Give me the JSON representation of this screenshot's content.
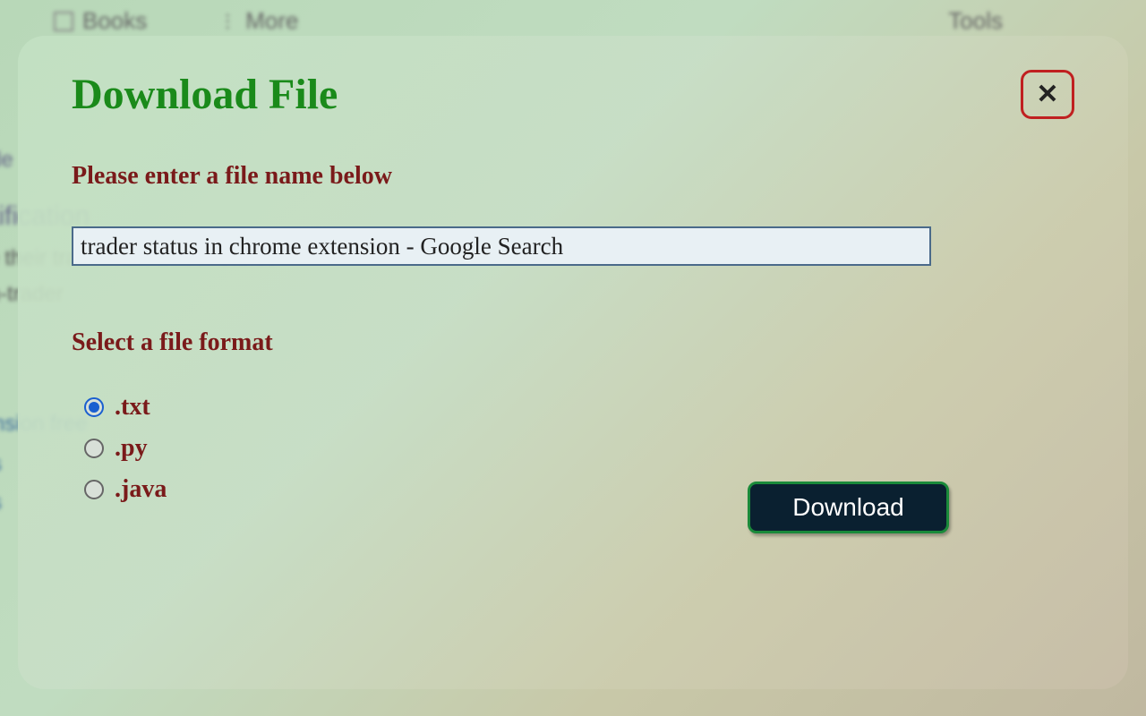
{
  "background": {
    "books": "Books",
    "more": "More",
    "tools": "Tools"
  },
  "modal": {
    "title": "Download File",
    "close_symbol": "✕",
    "filename_label": "Please enter a file name below",
    "filename_value": "trader status in chrome extension - Google Search",
    "format_label": "Select a file format",
    "formats": [
      {
        "label": ".txt",
        "checked": true
      },
      {
        "label": ".py",
        "checked": false
      },
      {
        "label": ".java",
        "checked": false
      }
    ],
    "download_label": "Download"
  }
}
